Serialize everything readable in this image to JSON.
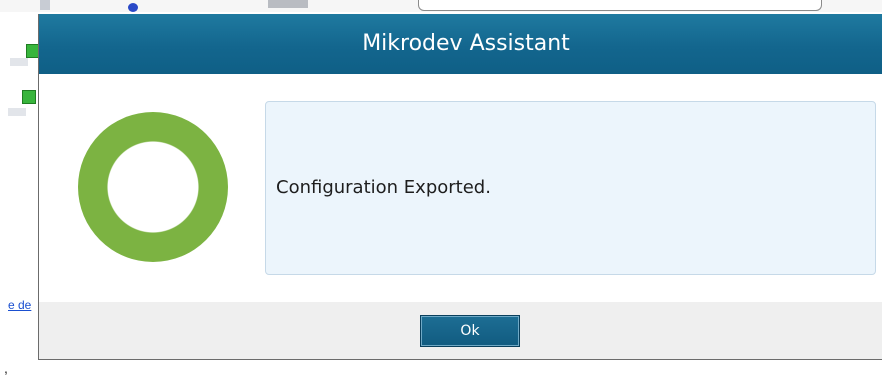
{
  "background": {
    "link_text": "e de",
    "stray_text": ","
  },
  "dialog": {
    "title": "Mikrodev Assistant",
    "message": "Configuration Exported.",
    "ok_label": "Ok",
    "status_icon": "success-ring-icon",
    "colors": {
      "title_bar": "#13668e",
      "ring": "#7cb342",
      "panel": "#ecf5fc",
      "button": "#115b80"
    }
  }
}
